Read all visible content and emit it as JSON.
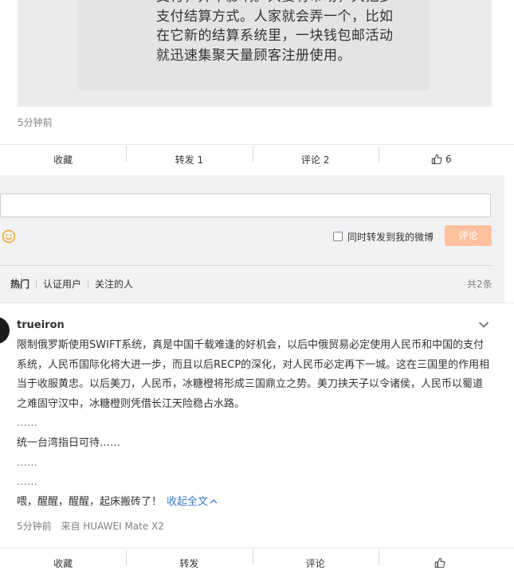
{
  "quoted_post": {
    "text": "支付，并不影响。只要有市场，大把多\n支付结算方式。人家就会弄一个，比如\n在它新的结算系统里，一块钱包邮活动\n就迅速集聚天量顾客注册使用。",
    "time": "5分钟前"
  },
  "actions": {
    "collect": "收藏",
    "repost": "转发 1",
    "comment": "评论 2",
    "like": "6"
  },
  "comment_box": {
    "placeholder": "",
    "repost_label": "同时转发到我的微博",
    "submit_label": "评论"
  },
  "comment_tabs": {
    "items": [
      "热门",
      "认证用户",
      "关注的人"
    ],
    "total": "共2条"
  },
  "comments": [
    {
      "username": "trueiron",
      "paragraphs": [
        "限制俄罗斯使用SWIFT系统，真是中国千载难逢的好机会，以后中俄贸易必定使用人民币和中国的支付系统，人民币国际化将大进一步，而且以后RECP的深化，对人民币必定再下一城。这在三国里的作用相当于收服黄忠。以后美刀，人民币，冰糖橙将形成三国鼎立之势。美刀挟天子以令诸侯，人民币以蜀道之难固守汉中，冰糖橙则凭借长江天险稳占水路。",
        "……",
        "统一台湾指日可待……",
        "……",
        "……",
        "喂，醒醒，醒醒，起床搬砖了！"
      ],
      "collapse_label": "收起全文",
      "time": "5分钟前",
      "source": "来自 HUAWEI Mate X2"
    }
  ],
  "bottom_actions": {
    "collect": "收藏",
    "repost": "转发",
    "comment": "评论"
  }
}
